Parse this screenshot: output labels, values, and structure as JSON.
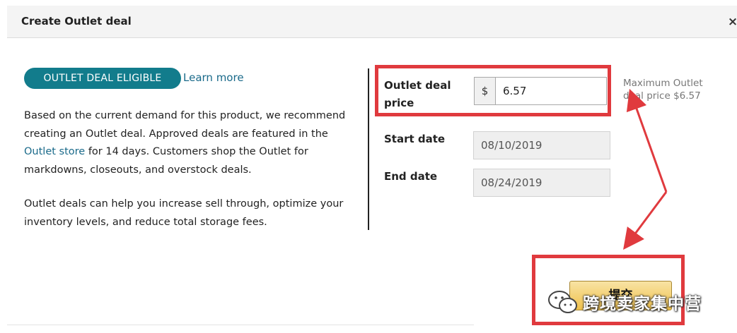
{
  "dialog": {
    "title": "Create Outlet deal",
    "close_label": "×"
  },
  "badge": {
    "label": "OUTLET DEAL ELIGIBLE"
  },
  "learn_more": "Learn more",
  "description": {
    "p1_before": "Based on the current demand for this product, we recommend creating an Outlet deal. Approved deals are featured in the ",
    "p1_link": "Outlet store",
    "p1_after": " for 14 days. Customers shop the Outlet for markdowns, closeouts, and overstock deals.",
    "p2": "Outlet deals can help you increase sell through, optimize your inventory levels, and reduce total storage fees."
  },
  "form": {
    "price_label": "Outlet deal price",
    "currency": "$",
    "price_value": "6.57",
    "max_note": "Maximum Outlet deal price $6.57",
    "start_label": "Start date",
    "start_value": "08/10/2019",
    "end_label": "End date",
    "end_value": "08/24/2019"
  },
  "submit": {
    "label": "提交"
  },
  "watermark": {
    "text": "跨境卖家集中营"
  },
  "colors": {
    "badge": "#127c8c",
    "link": "#1a6a8a",
    "highlight": "#e03a3e",
    "button": "#f0c14b"
  }
}
